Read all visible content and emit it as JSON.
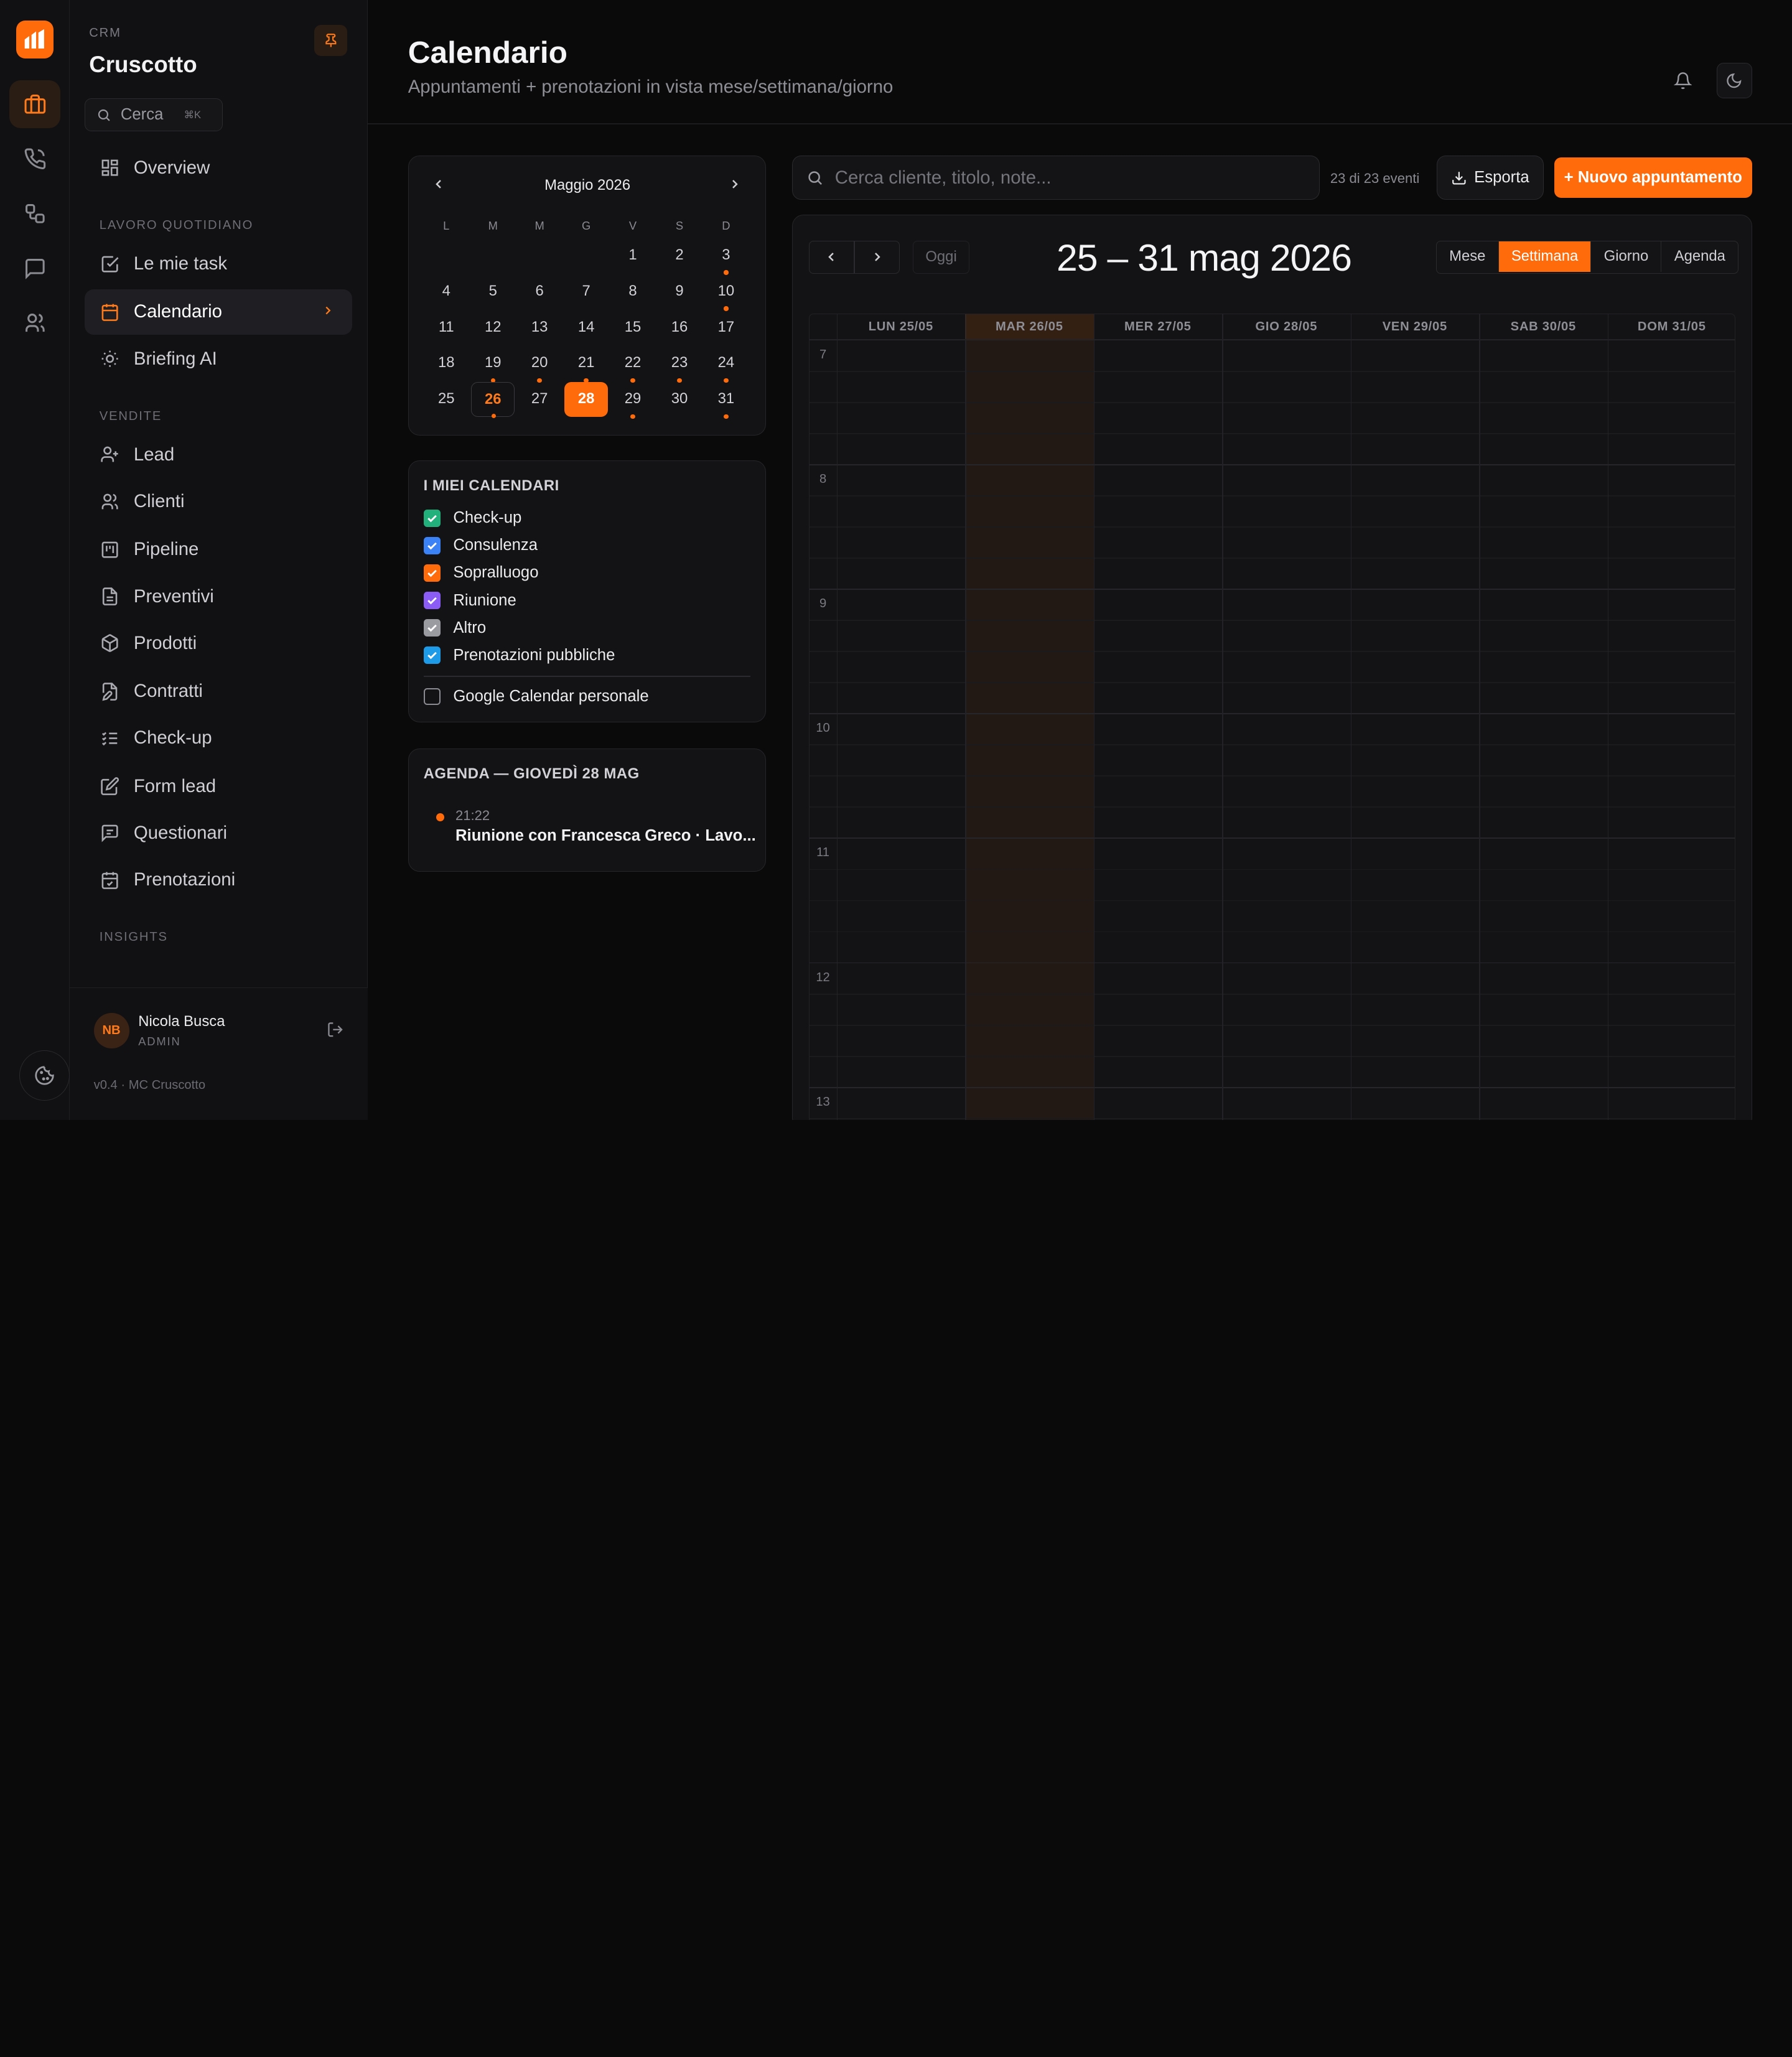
{
  "app": {
    "eyebrow": "CRM",
    "title": "Cruscotto",
    "version": "v0.4 · MC Cruscotto"
  },
  "search": {
    "label": "Cerca",
    "shortcut": "⌘K"
  },
  "sidebar": {
    "top": [
      {
        "label": "Overview",
        "icon": "grid-icon"
      }
    ],
    "sections": [
      {
        "title": "LAVORO QUOTIDIANO",
        "items": [
          {
            "label": "Le mie task",
            "icon": "checkbox-icon"
          },
          {
            "label": "Calendario",
            "icon": "calendar-icon",
            "active": true
          },
          {
            "label": "Briefing AI",
            "icon": "sun-icon"
          }
        ]
      },
      {
        "title": "VENDITE",
        "items": [
          {
            "label": "Lead",
            "icon": "user-plus-icon"
          },
          {
            "label": "Clienti",
            "icon": "users-icon"
          },
          {
            "label": "Pipeline",
            "icon": "kanban-icon"
          },
          {
            "label": "Preventivi",
            "icon": "document-icon"
          },
          {
            "label": "Prodotti",
            "icon": "box-icon"
          },
          {
            "label": "Contratti",
            "icon": "file-edit-icon"
          },
          {
            "label": "Check-up",
            "icon": "list-check-icon"
          },
          {
            "label": "Form lead",
            "icon": "pencil-square-icon"
          },
          {
            "label": "Questionari",
            "icon": "message-square-icon"
          },
          {
            "label": "Prenotazioni",
            "icon": "calendar-check-icon"
          }
        ]
      },
      {
        "title": "INSIGHTS",
        "items": []
      }
    ]
  },
  "user": {
    "initials": "NB",
    "name": "Nicola Busca",
    "role": "ADMIN"
  },
  "page": {
    "title": "Calendario",
    "subtitle": "Appuntamenti + prenotazioni in vista mese/settimana/giorno"
  },
  "mini_calendar": {
    "month_label": "Maggio 2026",
    "weekdays": [
      "L",
      "M",
      "M",
      "G",
      "V",
      "S",
      "D"
    ],
    "first_weekday_index": 4,
    "days_in_month": 31,
    "today": 26,
    "selected": 28,
    "event_days": [
      3,
      10,
      19,
      20,
      21,
      22,
      23,
      24,
      26,
      29,
      31
    ]
  },
  "calendars": {
    "title": "I MIEI CALENDARI",
    "items": [
      {
        "label": "Check-up",
        "color": "#22b07d",
        "checked": true
      },
      {
        "label": "Consulenza",
        "color": "#3b82f6",
        "checked": true
      },
      {
        "label": "Sopralluogo",
        "color": "#ff6b0a",
        "checked": true
      },
      {
        "label": "Riunione",
        "color": "#8b5cf6",
        "checked": true
      },
      {
        "label": "Altro",
        "color": "#9a9aa1",
        "checked": true
      },
      {
        "label": "Prenotazioni pubbliche",
        "color": "#1e9be8",
        "checked": true
      }
    ],
    "external": {
      "label": "Google Calendar personale",
      "checked": false
    }
  },
  "agenda": {
    "title": "AGENDA — GIOVEDÌ 28 MAG",
    "events": [
      {
        "time": "21:22",
        "text": "Riunione con Francesca Greco · Lavo..."
      }
    ]
  },
  "toolbar": {
    "search_placeholder": "Cerca cliente, titolo, note...",
    "event_count": "23 di 23 eventi",
    "export_label": "Esporta",
    "new_label": "+ Nuovo appuntamento"
  },
  "week_view": {
    "today_label": "Oggi",
    "range_label": "25 – 31 mag 2026",
    "views": [
      "Mese",
      "Settimana",
      "Giorno",
      "Agenda"
    ],
    "active_view": "Settimana",
    "columns": [
      "LUN 25/05",
      "MAR 26/05",
      "MER 27/05",
      "GIO 28/05",
      "VEN 29/05",
      "SAB 30/05",
      "DOM 31/05"
    ],
    "today_column": 1,
    "hours": [
      "7",
      "8",
      "9",
      "10",
      "11",
      "12",
      "13"
    ]
  },
  "colors": {
    "accent": "#ff6b0a",
    "fab": "#d946ef"
  }
}
